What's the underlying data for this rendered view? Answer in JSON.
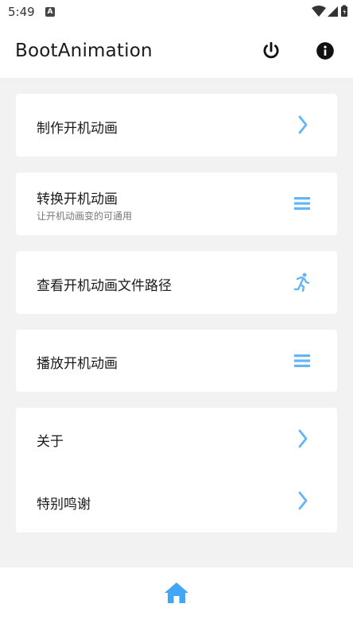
{
  "status_bar": {
    "time": "5:49",
    "notification_badge": "A",
    "icons": [
      "wifi-icon",
      "signal-icon",
      "battery-icon"
    ]
  },
  "app_bar": {
    "title": "BootAnimation",
    "actions": [
      "power-icon",
      "info-icon"
    ]
  },
  "menu": [
    {
      "title": "制作开机动画",
      "icon": "chevron-right-icon"
    },
    {
      "title": "转换开机动画",
      "subtitle": "让开机动画变的可通用",
      "icon": "menu-icon"
    },
    {
      "title": "查看开机动画文件路径",
      "icon": "run-icon"
    },
    {
      "title": "播放开机动画",
      "icon": "menu-icon"
    }
  ],
  "extra_menu": [
    {
      "title": "关于",
      "icon": "chevron-right-icon"
    },
    {
      "title": "特别鸣谢",
      "icon": "chevron-right-icon"
    }
  ],
  "bottom_nav": {
    "icon": "home-icon"
  },
  "colors": {
    "accent": "#64b5f6",
    "home": "#42a5f5",
    "background": "#f2f2f2",
    "card": "#ffffff"
  }
}
